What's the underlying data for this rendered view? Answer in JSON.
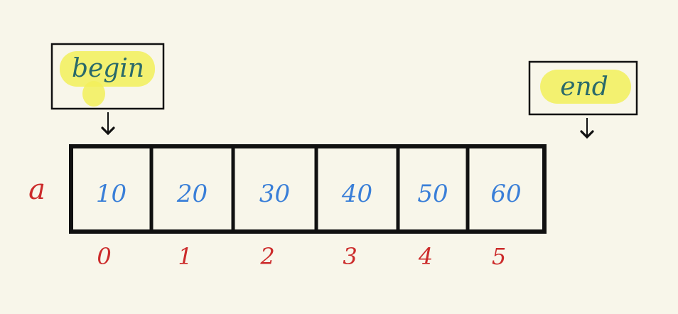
{
  "array": {
    "name": "a",
    "values": [
      "10",
      "20",
      "30",
      "40",
      "50",
      "60"
    ],
    "indices": [
      "0",
      "1",
      "2",
      "3",
      "4",
      "5"
    ]
  },
  "pointers": {
    "begin": {
      "label": "begin",
      "target_index": 0
    },
    "end": {
      "label": "end",
      "target_index": 6
    }
  },
  "colors": {
    "background": "#f8f6ea",
    "value_text": "#3a7fd8",
    "index_text": "#cc2b2b",
    "label_text": "#2a6a6a",
    "highlight": "#f2f05a",
    "outline": "#111111"
  }
}
